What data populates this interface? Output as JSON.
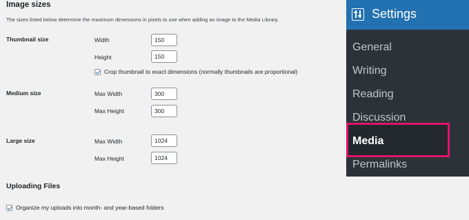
{
  "image_sizes": {
    "heading": "Image sizes",
    "description": "The sizes listed below determine the maximum dimensions in pixels to use when adding an image to the Media Library."
  },
  "thumbnail": {
    "label": "Thumbnail size",
    "width_label": "Width",
    "width_value": "150",
    "height_label": "Height",
    "height_value": "150",
    "crop_label": "Crop thumbnail to exact dimensions (normally thumbnails are proportional)",
    "crop_checked": true
  },
  "medium": {
    "label": "Medium size",
    "max_width_label": "Max Width",
    "max_width_value": "300",
    "max_height_label": "Max Height",
    "max_height_value": "300"
  },
  "large": {
    "label": "Large size",
    "max_width_label": "Max Width",
    "max_width_value": "1024",
    "max_height_label": "Max Height",
    "max_height_value": "1024"
  },
  "uploading": {
    "heading": "Uploading Files",
    "organize_label": "Organize my uploads into month- and year-based folders",
    "organize_checked": true
  },
  "sidebar": {
    "title": "Settings",
    "icon": "settings-sliders-icon",
    "items": [
      {
        "label": "General"
      },
      {
        "label": "Writing"
      },
      {
        "label": "Reading"
      },
      {
        "label": "Discussion"
      },
      {
        "label": "Media"
      },
      {
        "label": "Permalinks"
      }
    ],
    "active_index": 4
  },
  "colors": {
    "sidebar_bg": "#2c3338",
    "header_bg": "#2271b1",
    "highlight": "#e0136a"
  }
}
